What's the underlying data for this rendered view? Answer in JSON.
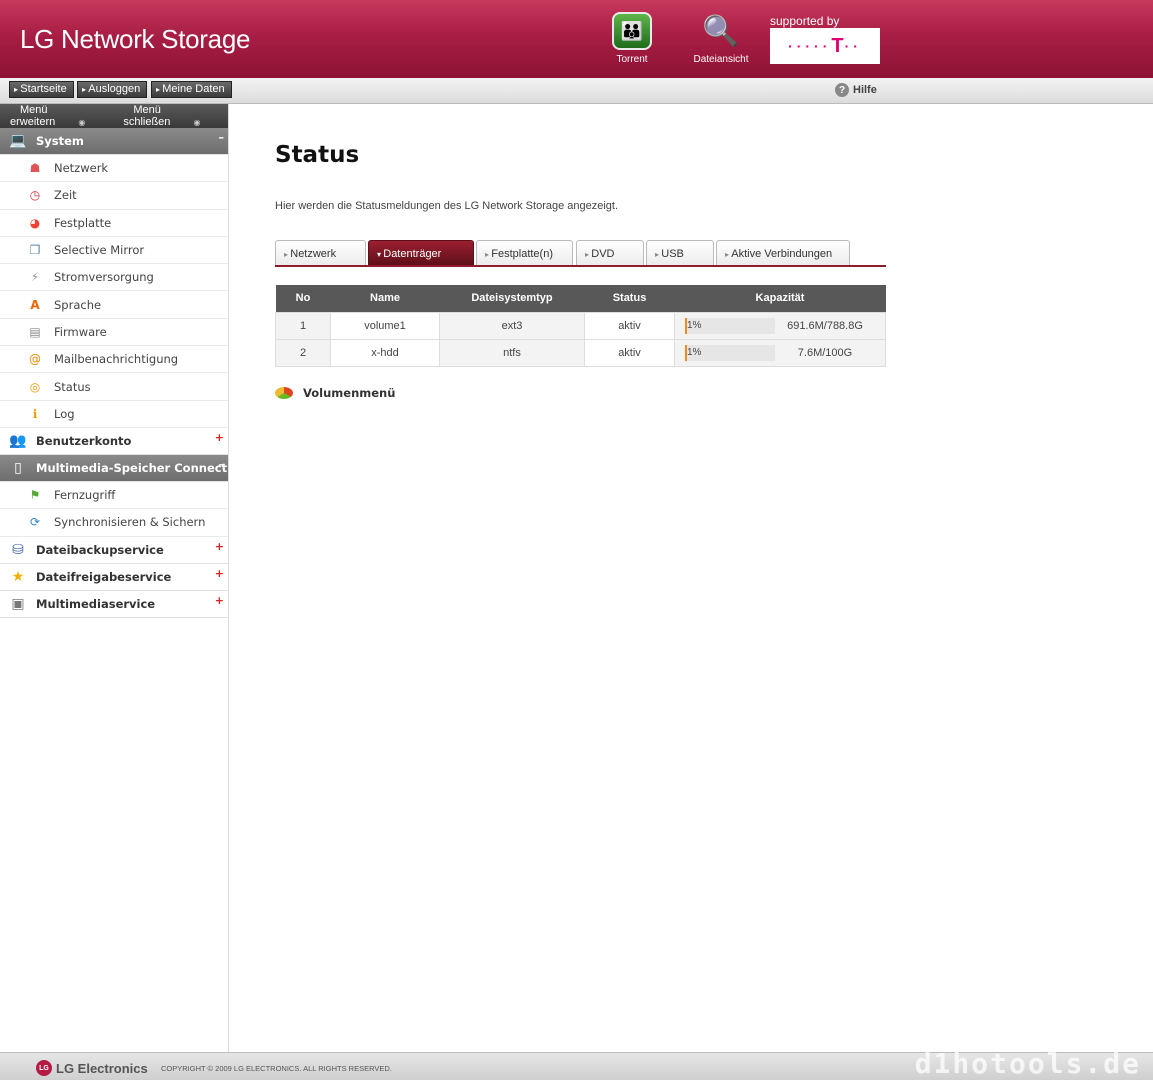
{
  "header": {
    "title": "LG Network Storage",
    "torrent_label": "Torrent",
    "dateiansicht_label": "Dateiansicht",
    "supported_label": "supported by",
    "telekom_logo": "T"
  },
  "topnav": {
    "startseite": "Startseite",
    "ausloggen": "Ausloggen",
    "meine_daten": "Meine Daten",
    "hilfe": "Hilfe"
  },
  "sidebar": {
    "expand": "Menü erweitern",
    "collapse": "Menü schließen",
    "system": {
      "label": "System",
      "items": [
        {
          "label": "Netzwerk",
          "icon": "network-icon"
        },
        {
          "label": "Zeit",
          "icon": "clock-icon"
        },
        {
          "label": "Festplatte",
          "icon": "disk-pie-icon"
        },
        {
          "label": "Selective Mirror",
          "icon": "mirror-icon"
        },
        {
          "label": "Stromversorgung",
          "icon": "power-icon"
        },
        {
          "label": "Sprache",
          "icon": "language-icon"
        },
        {
          "label": "Firmware",
          "icon": "firmware-icon"
        },
        {
          "label": "Mailbenachrichtigung",
          "icon": "mail-icon"
        },
        {
          "label": "Status",
          "icon": "status-icon"
        },
        {
          "label": "Log",
          "icon": "log-icon"
        }
      ]
    },
    "benutzerkonto": "Benutzerkonto",
    "multimedia_connect": {
      "label": "Multimedia-Speicher Connect",
      "items": [
        {
          "label": "Fernzugriff",
          "icon": "remote-icon"
        },
        {
          "label": "Synchronisieren & Sichern",
          "icon": "sync-icon"
        }
      ]
    },
    "dateibackupservice": "Dateibackupservice",
    "dateifreigabeservice": "Dateifreigabeservice",
    "multimediaservice": "Multimediaservice"
  },
  "main": {
    "title": "Status",
    "description": "Hier werden die Statusmeldungen des LG Network Storage angezeigt.",
    "tabs": [
      "Netzwerk",
      "Datenträger",
      "Festplatte(n)",
      "DVD",
      "USB",
      "Aktive Verbindungen"
    ],
    "active_tab": "Datenträger",
    "table": {
      "headers": [
        "No",
        "Name",
        "Dateisystemtyp",
        "Status",
        "Kapazität"
      ],
      "rows": [
        {
          "no": "1",
          "name": "volume1",
          "fs": "ext3",
          "status": "aktiv",
          "usage_percent": 1,
          "usage_label": "1%",
          "capacity": "691.6M/788.8G"
        },
        {
          "no": "2",
          "name": "x-hdd",
          "fs": "ntfs",
          "status": "aktiv",
          "usage_percent": 1,
          "usage_label": "1%",
          "capacity": "7.6M/100G"
        }
      ]
    },
    "volumenmenu": "Volumenmenü"
  },
  "footer": {
    "brand": "LG Electronics",
    "copyright": "COPYRIGHT © 2009 LG ELECTRONICS. ALL RIGHTS RESERVED.",
    "watermark": "d1hotools.de"
  },
  "colors": {
    "header": "#a81e44",
    "active_tab": "#8e1c2c",
    "usage_bar": "#f08a1c",
    "telekom_magenta": "#e20074"
  }
}
